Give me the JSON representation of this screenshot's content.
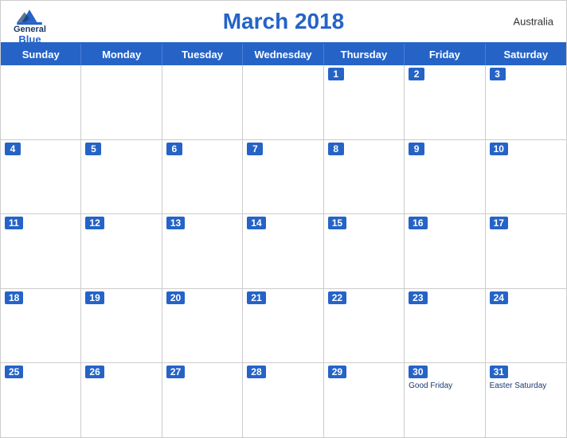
{
  "header": {
    "logo": {
      "general": "General",
      "blue": "Blue",
      "icon": "mountain"
    },
    "title": "March 2018",
    "country": "Australia"
  },
  "dayHeaders": [
    "Sunday",
    "Monday",
    "Tuesday",
    "Wednesday",
    "Thursday",
    "Friday",
    "Saturday"
  ],
  "weeks": [
    [
      {
        "day": "",
        "empty": true
      },
      {
        "day": "",
        "empty": true
      },
      {
        "day": "",
        "empty": true
      },
      {
        "day": "",
        "empty": true
      },
      {
        "day": "1",
        "empty": false
      },
      {
        "day": "2",
        "empty": false
      },
      {
        "day": "3",
        "empty": false
      }
    ],
    [
      {
        "day": "4",
        "empty": false
      },
      {
        "day": "5",
        "empty": false
      },
      {
        "day": "6",
        "empty": false
      },
      {
        "day": "7",
        "empty": false
      },
      {
        "day": "8",
        "empty": false
      },
      {
        "day": "9",
        "empty": false
      },
      {
        "day": "10",
        "empty": false
      }
    ],
    [
      {
        "day": "11",
        "empty": false
      },
      {
        "day": "12",
        "empty": false
      },
      {
        "day": "13",
        "empty": false
      },
      {
        "day": "14",
        "empty": false
      },
      {
        "day": "15",
        "empty": false
      },
      {
        "day": "16",
        "empty": false
      },
      {
        "day": "17",
        "empty": false
      }
    ],
    [
      {
        "day": "18",
        "empty": false
      },
      {
        "day": "19",
        "empty": false
      },
      {
        "day": "20",
        "empty": false
      },
      {
        "day": "21",
        "empty": false
      },
      {
        "day": "22",
        "empty": false
      },
      {
        "day": "23",
        "empty": false
      },
      {
        "day": "24",
        "empty": false
      }
    ],
    [
      {
        "day": "25",
        "empty": false
      },
      {
        "day": "26",
        "empty": false
      },
      {
        "day": "27",
        "empty": false
      },
      {
        "day": "28",
        "empty": false
      },
      {
        "day": "29",
        "empty": false
      },
      {
        "day": "30",
        "empty": false,
        "holiday": "Good Friday"
      },
      {
        "day": "31",
        "empty": false,
        "holiday": "Easter Saturday"
      }
    ]
  ]
}
